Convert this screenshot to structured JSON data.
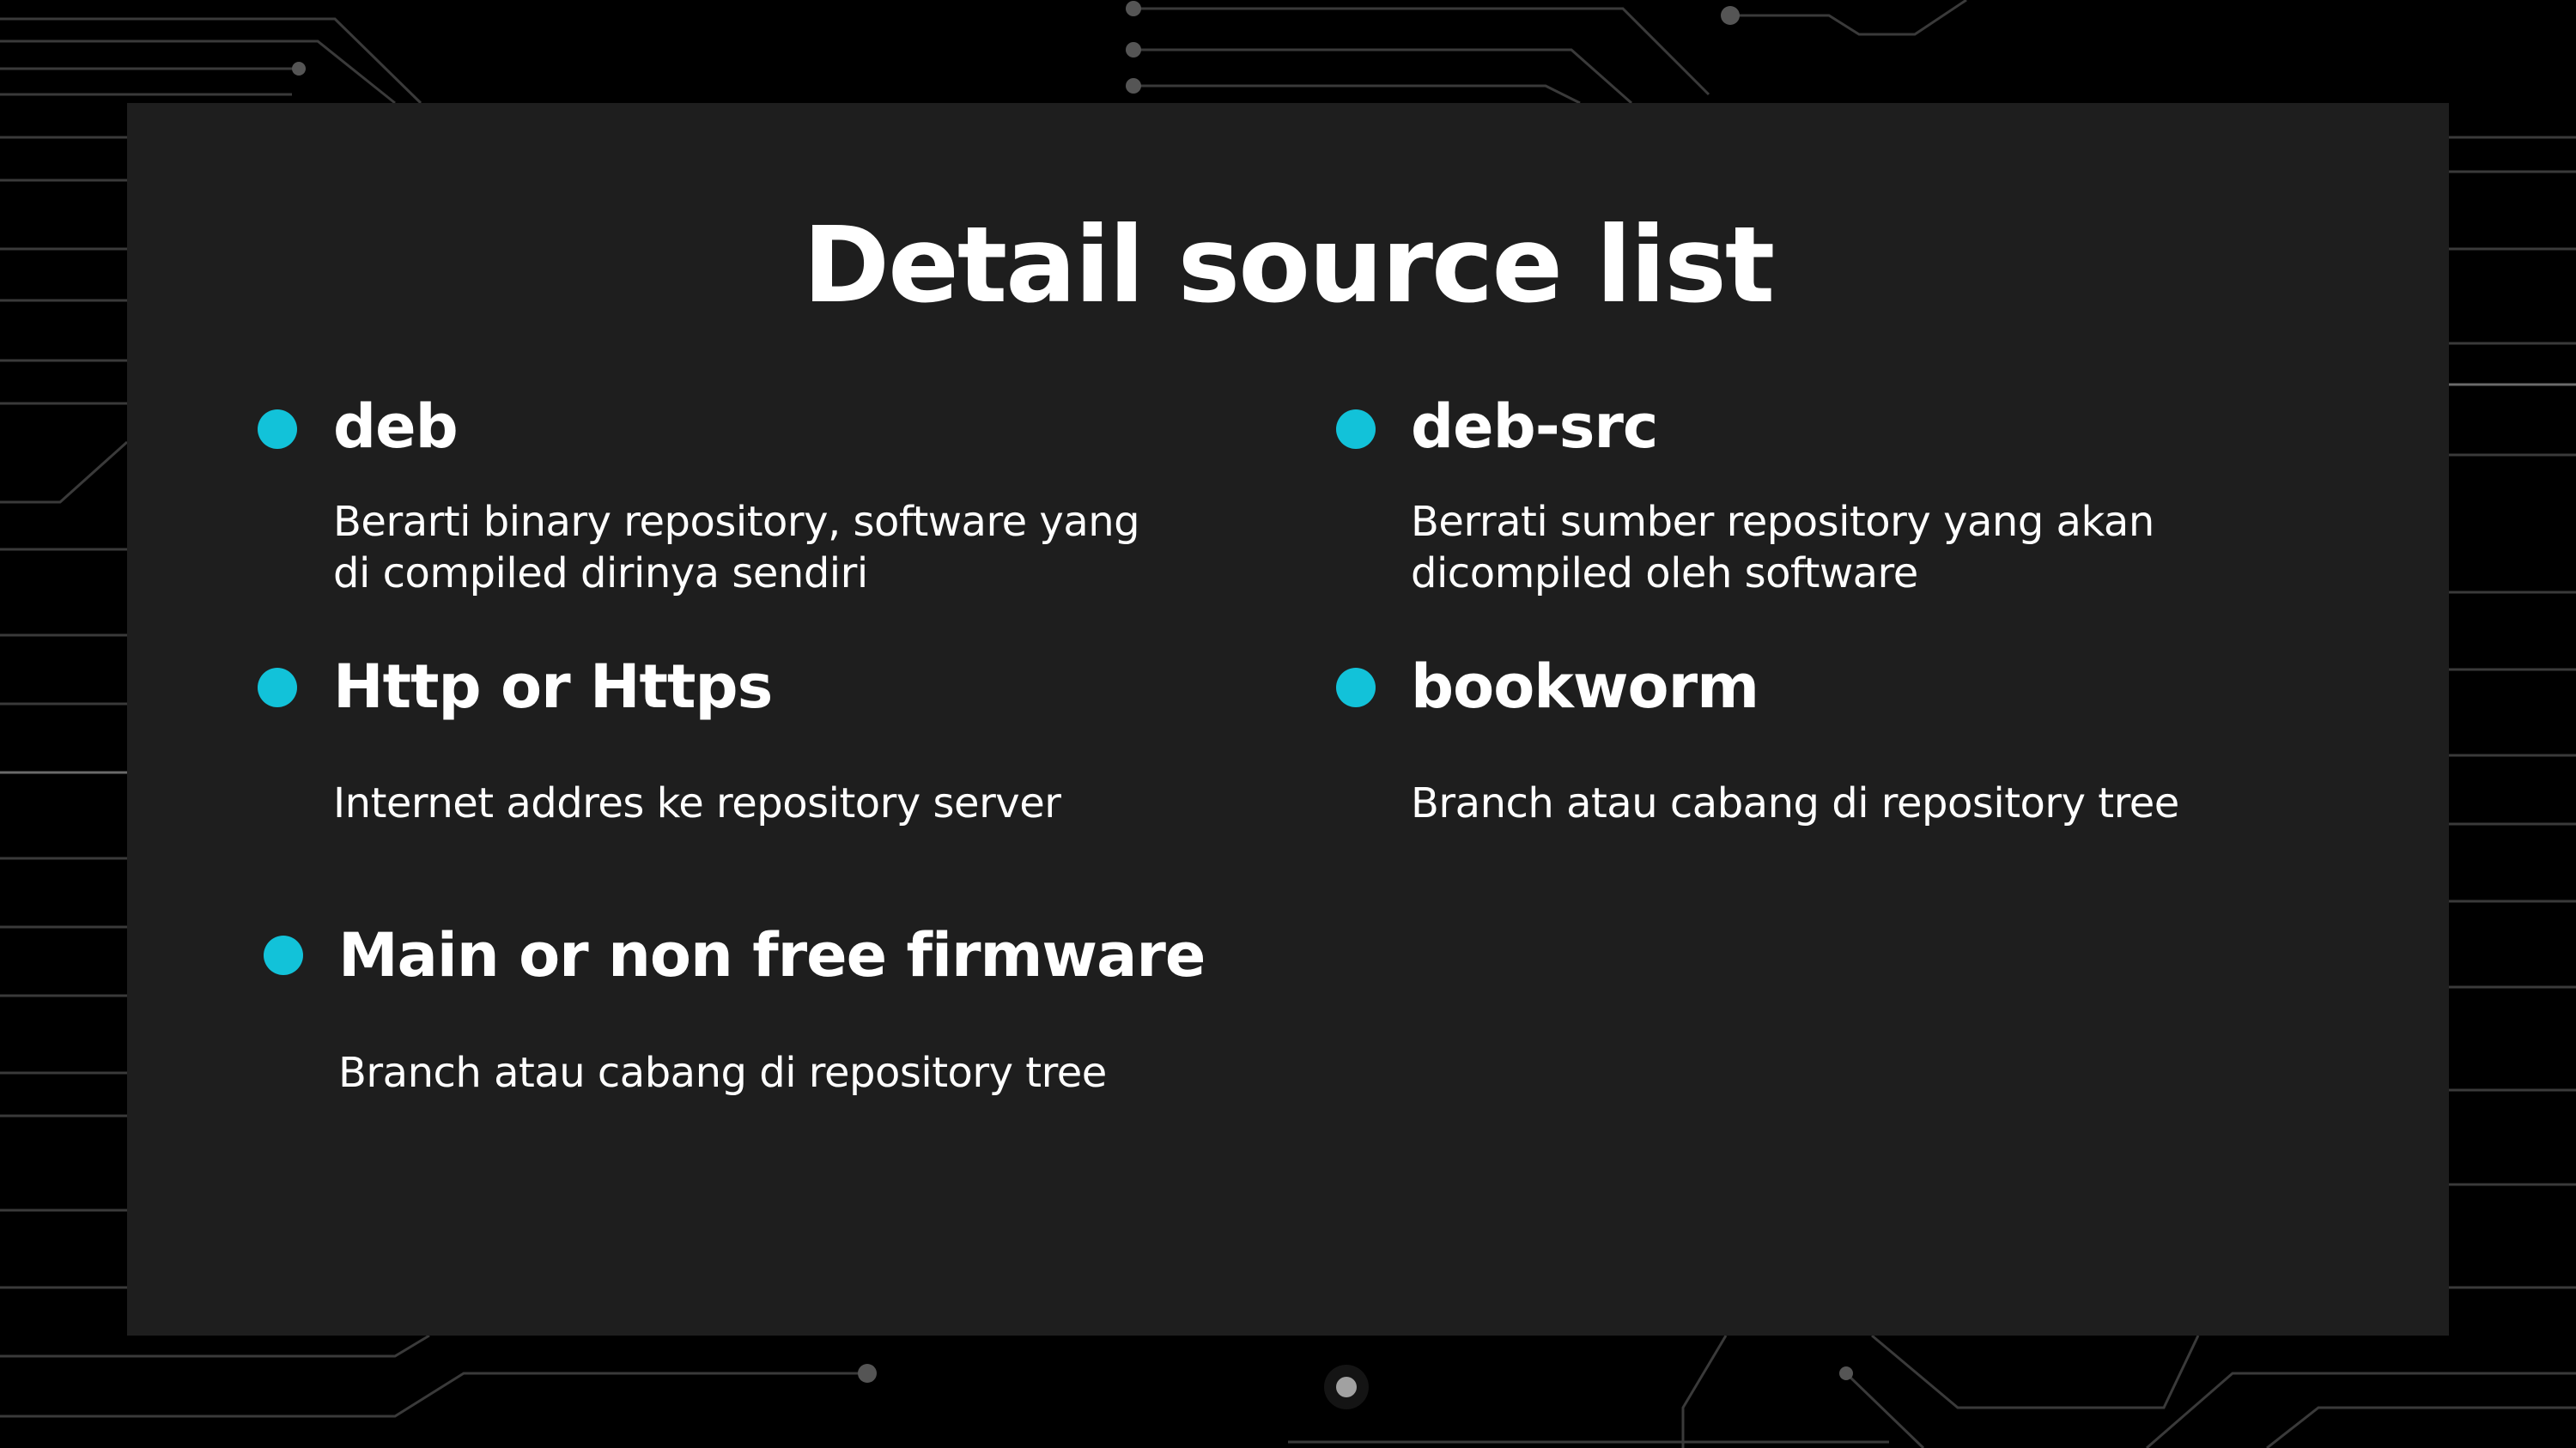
{
  "slide": {
    "title": "Detail source list",
    "items": [
      {
        "term": "deb",
        "description": "Berarti binary repository, software yang di compiled dirinya sendiri"
      },
      {
        "term": "deb-src",
        "description": "Berrati sumber repository yang akan dicompiled oleh software"
      },
      {
        "term": "Http or Https",
        "description": "Internet addres ke repository server"
      },
      {
        "term": "bookworm",
        "description": "Branch atau cabang di repository tree"
      },
      {
        "term": "Main or non free firmware",
        "description": "Branch atau cabang di repository tree"
      }
    ]
  },
  "colors": {
    "background": "#000000",
    "panel": "#1e1e1e",
    "accent": "#12c2d9",
    "text": "#ffffff",
    "circuit": "#3a3a3a"
  },
  "icons": {
    "bullet": "cyan-dot-icon",
    "background": "circuit-board-pattern"
  }
}
